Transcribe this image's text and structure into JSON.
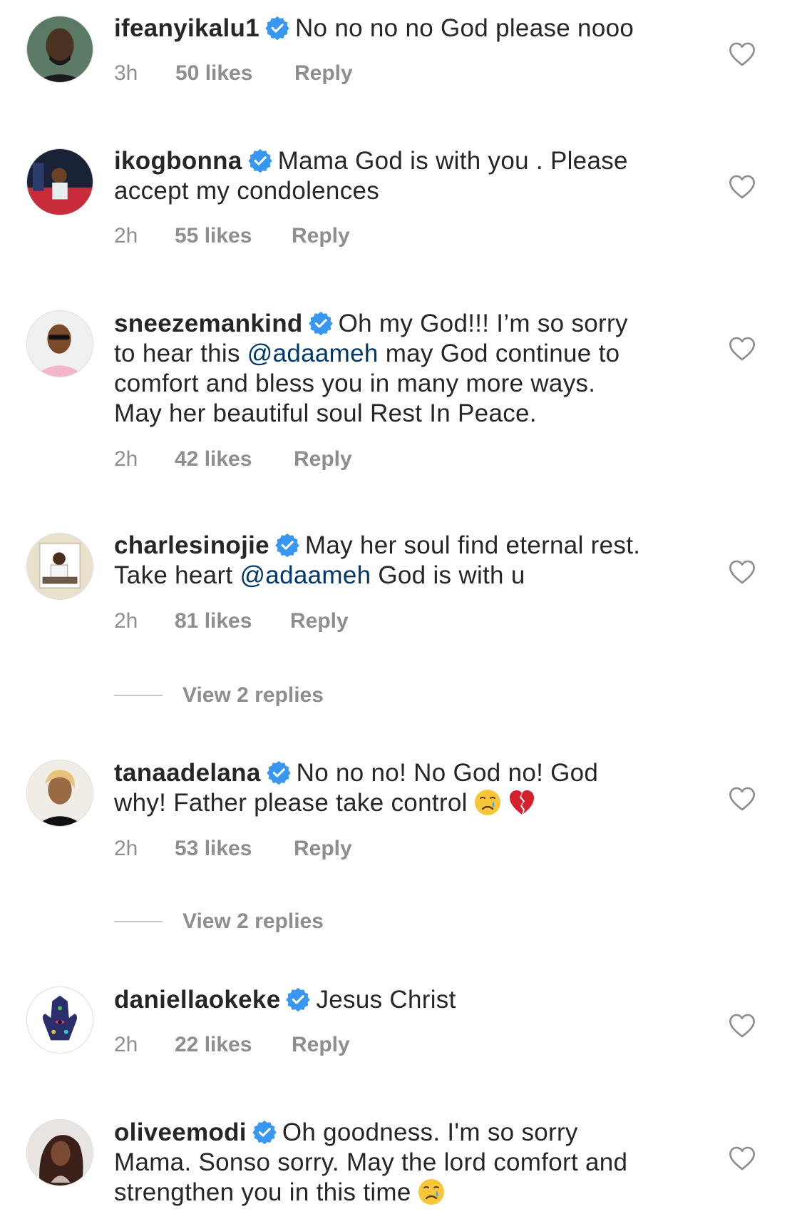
{
  "comments": [
    {
      "username": "ifeanyikalu1",
      "text": [
        "No no no no God please nooo"
      ],
      "time": "3h",
      "likes": "50 likes",
      "reply": "Reply"
    },
    {
      "username": "ikogbonna",
      "text": [
        "Mama God is with you . Please",
        "accept my condolences"
      ],
      "time": "2h",
      "likes": "55 likes",
      "reply": "Reply"
    },
    {
      "username": "sneezemankind",
      "text_a": "Oh my God!!! I’m so sorry",
      "text_b_pre": "to hear this ",
      "mention": "@adaameh",
      "text_b_post": " may God continue to",
      "text_c": "comfort and bless you in many more ways.",
      "text_d": "May her beautiful soul Rest In Peace.",
      "time": "2h",
      "likes": "42 likes",
      "reply": "Reply"
    },
    {
      "username": "charlesinojie",
      "text_a": "May her soul find eternal rest.",
      "text_b_pre": "Take heart ",
      "mention": "@adaameh",
      "text_b_post": " God is with u",
      "time": "2h",
      "likes": "81 likes",
      "reply": "Reply"
    },
    {
      "username": "tanaadelana",
      "text_a": "No no no! No God no! God",
      "text_b": "why! Father please take control",
      "time": "2h",
      "likes": "53 likes",
      "reply": "Reply"
    },
    {
      "username": "daniellaokeke",
      "text_a": "Jesus Christ",
      "time": "2h",
      "likes": "22 likes",
      "reply": "Reply"
    },
    {
      "username": "oliveemodi",
      "text_a": "Oh goodness. I'm so sorry",
      "text_b": "Mama. Sonso sorry. May the lord comfort and",
      "text_c": "strengthen you in this time"
    }
  ],
  "view_replies": [
    "View 2 replies",
    "View 2 replies"
  ],
  "colors": {
    "verified": "#3897f0",
    "mention": "#00376b",
    "muted": "#8e8e8e"
  },
  "icons": {
    "verified": "verified-badge-icon",
    "heart": "heart-outline-icon"
  }
}
